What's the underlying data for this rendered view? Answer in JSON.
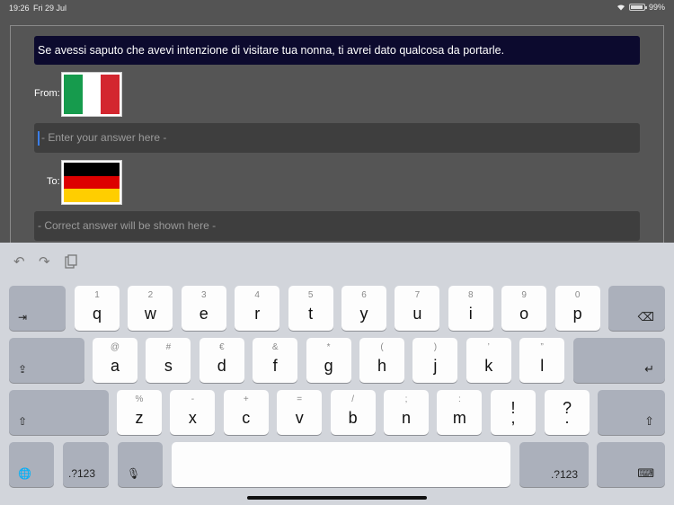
{
  "status_bar": {
    "time": "19:26",
    "date": "Fri 29 Jul",
    "battery": "99%"
  },
  "exercise": {
    "prompt": "Se avessi saputo che avevi intenzione di visitare tua nonna, ti avrei dato qualcosa da portarle.",
    "from_label": "From:",
    "to_label": "To:",
    "answer_placeholder": "- Enter your answer here -",
    "correct_placeholder": "- Correct answer will be shown here -",
    "from_flag_colors": [
      "#169b4d",
      "#ffffff",
      "#d3262f"
    ],
    "to_flag_colors": [
      "#000000",
      "#dd0000",
      "#ffce00"
    ]
  },
  "keyboard": {
    "toolbar": {
      "undo_icon": "↶",
      "redo_icon": "↷",
      "paste_icon": "paste-icon"
    },
    "row1": [
      {
        "hint": "1",
        "ch": "q"
      },
      {
        "hint": "2",
        "ch": "w"
      },
      {
        "hint": "3",
        "ch": "e"
      },
      {
        "hint": "4",
        "ch": "r"
      },
      {
        "hint": "5",
        "ch": "t"
      },
      {
        "hint": "6",
        "ch": "y"
      },
      {
        "hint": "7",
        "ch": "u"
      },
      {
        "hint": "8",
        "ch": "i"
      },
      {
        "hint": "9",
        "ch": "o"
      },
      {
        "hint": "0",
        "ch": "p"
      }
    ],
    "row2": [
      {
        "hint": "@",
        "ch": "a"
      },
      {
        "hint": "#",
        "ch": "s"
      },
      {
        "hint": "€",
        "ch": "d"
      },
      {
        "hint": "&",
        "ch": "f"
      },
      {
        "hint": "*",
        "ch": "g"
      },
      {
        "hint": "(",
        "ch": "h"
      },
      {
        "hint": ")",
        "ch": "j"
      },
      {
        "hint": "’",
        "ch": "k"
      },
      {
        "hint": "”",
        "ch": "l"
      }
    ],
    "row3": [
      {
        "hint": "%",
        "ch": "z"
      },
      {
        "hint": "-",
        "ch": "x"
      },
      {
        "hint": "+",
        "ch": "c"
      },
      {
        "hint": "=",
        "ch": "v"
      },
      {
        "hint": "/",
        "ch": "b"
      },
      {
        "hint": ";",
        "ch": "n"
      },
      {
        "hint": ":",
        "ch": "m"
      }
    ],
    "punct": [
      {
        "top": "!",
        "bottom": ","
      },
      {
        "top": "?",
        "bottom": "."
      }
    ],
    "labels": {
      "tab": "⇥",
      "delete": "⌫",
      "caps": "⇪",
      "return": "↵",
      "shift": "⇧",
      "globe": "🌐",
      "numbers": ".?123",
      "mic": "🎙",
      "hide": "⌨"
    }
  }
}
